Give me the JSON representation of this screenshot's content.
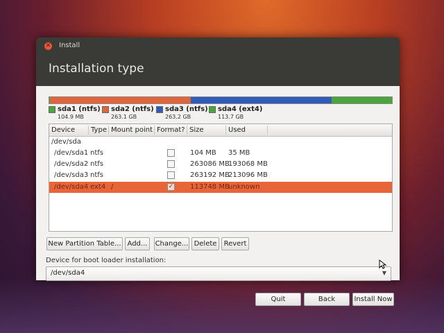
{
  "window": {
    "title": "Install",
    "close_symbol": "✕"
  },
  "page": {
    "title": "Installation type"
  },
  "partitions": [
    {
      "name": "sda1 (ntfs)",
      "size": "104.9 MB",
      "color": "#4aa63c",
      "fraction": 0.0003
    },
    {
      "name": "sda2 (ntfs)",
      "size": "263.1 GB",
      "color": "#e0653a",
      "fraction": 0.4152
    },
    {
      "name": "sda3 (ntfs)",
      "size": "263.2 GB",
      "color": "#2e5cb8",
      "fraction": 0.4153
    },
    {
      "name": "sda4 (ext4)",
      "size": "113.7 GB",
      "color": "#4aa63c",
      "fraction": 0.1792
    }
  ],
  "table": {
    "headers": {
      "device": "Device",
      "type": "Type",
      "mount": "Mount point",
      "format": "Format?",
      "size": "Size",
      "used": "Used"
    },
    "rows": [
      {
        "device": "/dev/sda",
        "type": "",
        "mount": "",
        "format": null,
        "size": "",
        "used": "",
        "selected": false
      },
      {
        "device": "/dev/sda1",
        "type": "ntfs",
        "mount": "",
        "format": false,
        "size": "104 MB",
        "used": "35 MB",
        "selected": false
      },
      {
        "device": "/dev/sda2",
        "type": "ntfs",
        "mount": "",
        "format": false,
        "size": "263086 MB",
        "used": "193068 MB",
        "selected": false
      },
      {
        "device": "/dev/sda3",
        "type": "ntfs",
        "mount": "",
        "format": false,
        "size": "263192 MB",
        "used": "213096 MB",
        "selected": false
      },
      {
        "device": "/dev/sda4",
        "type": "ext4",
        "mount": "/",
        "format": true,
        "size": "113748 MB",
        "used": "unknown",
        "selected": true
      }
    ]
  },
  "buttons": {
    "new_table": "New Partition Table...",
    "add": "Add...",
    "change": "Change...",
    "delete": "Delete",
    "revert": "Revert"
  },
  "bootloader": {
    "label": "Device for boot loader installation:",
    "value": "/dev/sda4",
    "arrow": "▼"
  },
  "actions": {
    "quit": "Quit",
    "back": "Back",
    "install": "Install Now"
  },
  "checkmark": "✓",
  "colors": {
    "selection": "#e8653a",
    "panel": "#f2f1f0",
    "window_dark": "#3a3a36"
  }
}
